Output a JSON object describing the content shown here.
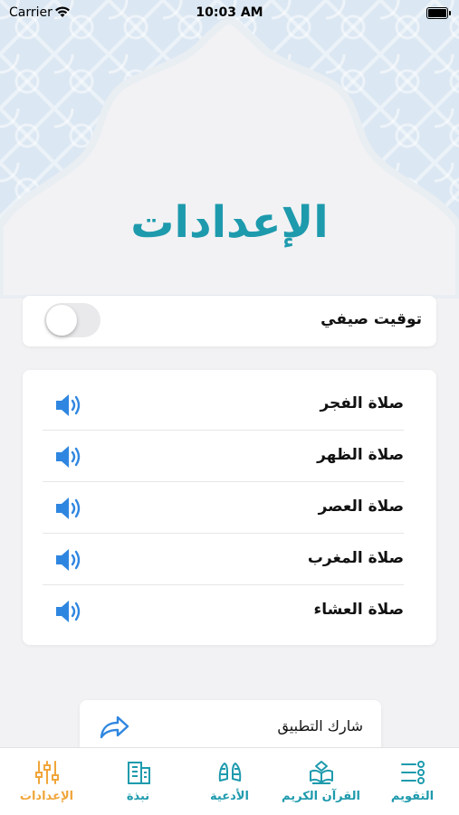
{
  "status_bar": {
    "carrier": "Carrier",
    "time": "10:03 AM"
  },
  "page_title": "الإعدادات",
  "daylight_saving": {
    "label": "توقيت صيفي",
    "enabled": false
  },
  "prayers": [
    {
      "label": "صلاة الفجر",
      "sound_icon": "speaker-icon"
    },
    {
      "label": "صلاة الظهر",
      "sound_icon": "speaker-icon"
    },
    {
      "label": "صلاة العصر",
      "sound_icon": "speaker-icon"
    },
    {
      "label": "صلاة المغرب",
      "sound_icon": "speaker-icon"
    },
    {
      "label": "صلاة العشاء",
      "sound_icon": "speaker-icon"
    }
  ],
  "share": {
    "label": "شارك التطبيق",
    "icon": "share-arrow-icon"
  },
  "tabs": [
    {
      "label": "الإعدادات",
      "icon": "sliders-icon",
      "active": true
    },
    {
      "label": "نبذة",
      "icon": "building-icon",
      "active": false
    },
    {
      "label": "الأدعية",
      "icon": "praying-hands-icon",
      "active": false
    },
    {
      "label": "القرآن الكريم",
      "icon": "quran-icon",
      "active": false
    },
    {
      "label": "التقويم",
      "icon": "list-icon",
      "active": false
    }
  ],
  "colors": {
    "accent": "#1e9aad",
    "active_tab": "#f0a63a",
    "speaker": "#2f86e0",
    "background": "#f2f2f4"
  }
}
